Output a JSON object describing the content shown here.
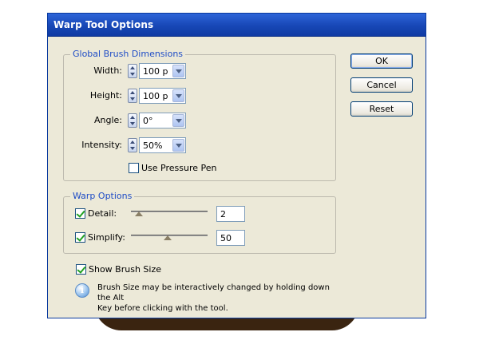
{
  "window": {
    "title": "Warp Tool Options"
  },
  "brush": {
    "legend": "Global Brush Dimensions",
    "width": {
      "label": "Width:",
      "value": "100 p"
    },
    "height": {
      "label": "Height:",
      "value": "100 p"
    },
    "angle": {
      "label": "Angle:",
      "value": "0°"
    },
    "intensity": {
      "label": "Intensity:",
      "value": "50%"
    },
    "pressure": {
      "label": "Use Pressure Pen",
      "checked": false
    }
  },
  "warp": {
    "legend": "Warp Options",
    "detail": {
      "label": "Detail:",
      "value": "2",
      "checked": true
    },
    "simplify": {
      "label": "Simplify:",
      "value": "50",
      "checked": true
    }
  },
  "show_brush": {
    "label": "Show Brush Size",
    "checked": true
  },
  "info": {
    "icon": "info-icon",
    "line1": "Brush Size may be interactively changed by holding down the Alt",
    "line2": "Key before clicking with the tool."
  },
  "buttons": {
    "ok": "OK",
    "cancel": "Cancel",
    "reset": "Reset"
  }
}
